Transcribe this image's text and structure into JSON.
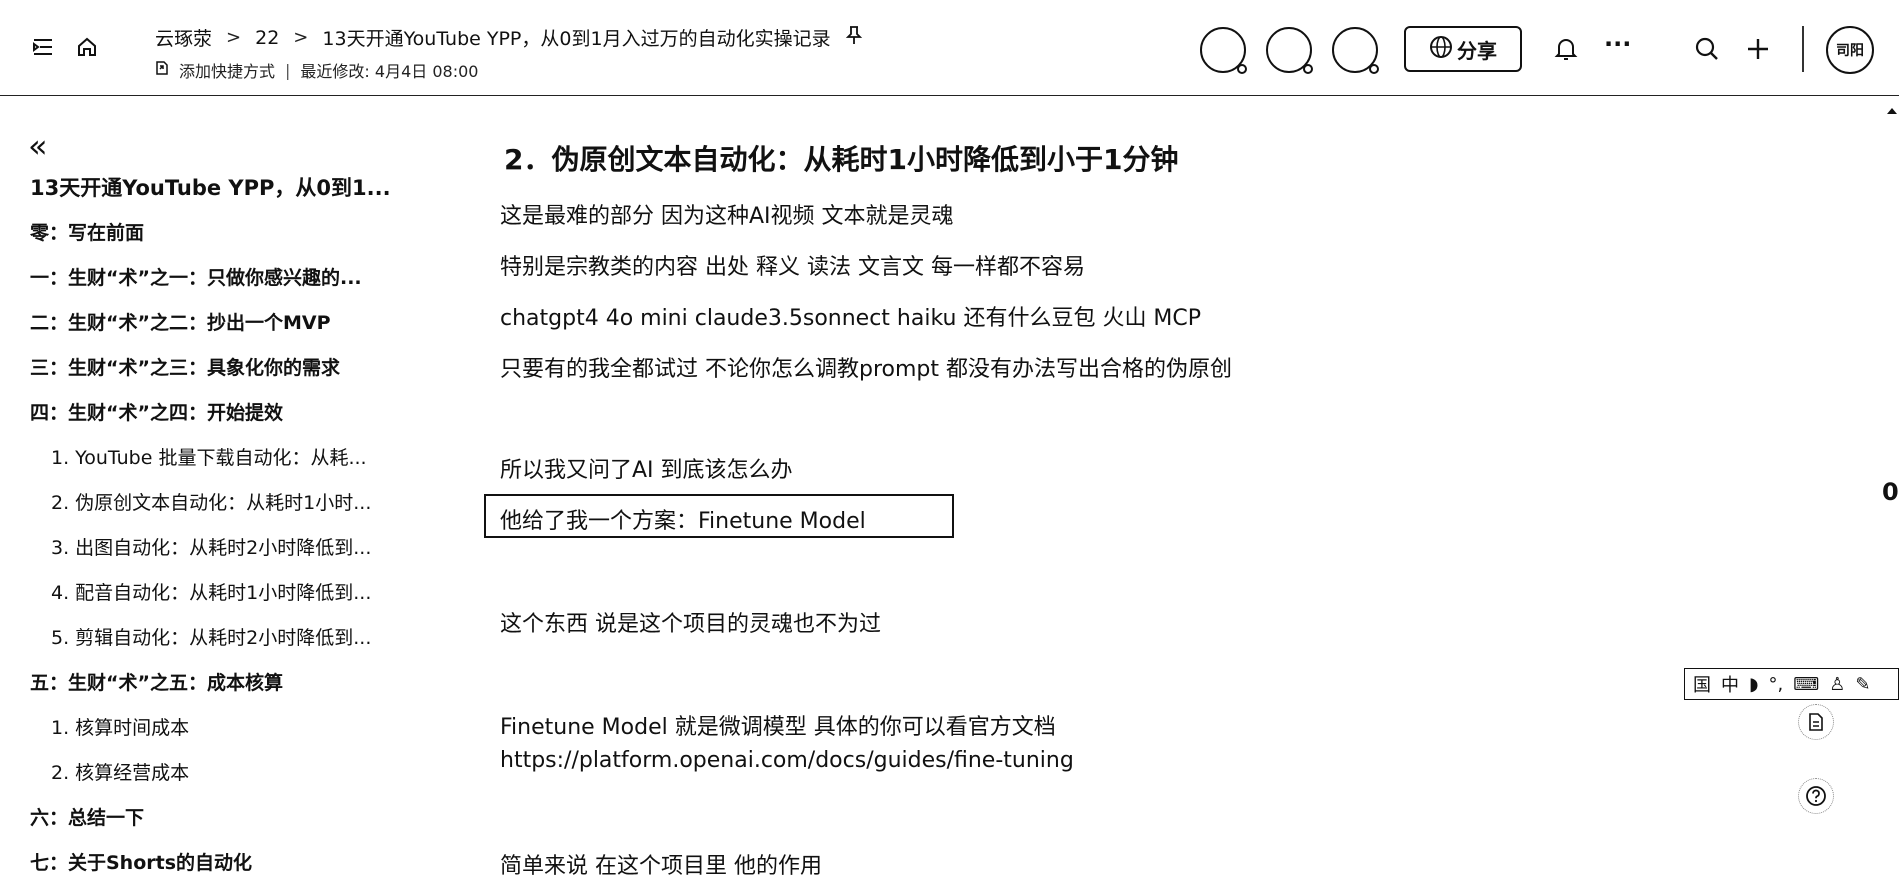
{
  "breadcrumb": {
    "items": [
      "云琢荥",
      "22",
      "13天开通YouTube YPP，从0到1月入过万的自动化实操记录"
    ],
    "pin_icon": "pin-icon"
  },
  "meta": {
    "add_shortcut": "添加快捷方式",
    "separator": "|",
    "last_modified": "最近修改: 4月4日 08:00"
  },
  "toolbar": {
    "share_label": "分享",
    "more_label": "···",
    "user_initials": "司阳"
  },
  "sidebar": {
    "collapse_label": "«",
    "items": [
      {
        "label": "13天开通YouTube YPP，从0到1...",
        "level": "title"
      },
      {
        "label": "零：写在前面",
        "level": "h"
      },
      {
        "label": "一：生财“术”之一：只做你感兴趣的...",
        "level": "h"
      },
      {
        "label": "二：生财“术”之二：抄出一个MVP",
        "level": "h"
      },
      {
        "label": "三：生财“术”之三：具象化你的需求",
        "level": "h"
      },
      {
        "label": "四：生财“术”之四：开始提效",
        "level": "h"
      },
      {
        "label": "1. YouTube 批量下载自动化：从耗...",
        "level": "sub"
      },
      {
        "label": "2. 伪原创文本自动化：从耗时1小时...",
        "level": "sub"
      },
      {
        "label": "3. 出图自动化：从耗时2小时降低到...",
        "level": "sub"
      },
      {
        "label": "4. 配音自动化：从耗时1小时降低到...",
        "level": "sub"
      },
      {
        "label": "5. 剪辑自动化：从耗时2小时降低到...",
        "level": "sub"
      },
      {
        "label": "五：生财“术”之五：成本核算",
        "level": "h"
      },
      {
        "label": "1. 核算时间成本",
        "level": "sub"
      },
      {
        "label": "2. 核算经营成本",
        "level": "sub"
      },
      {
        "label": "六：总结一下",
        "level": "h"
      },
      {
        "label": "七：关于Shorts的自动化",
        "level": "h"
      }
    ]
  },
  "article": {
    "heading": "2．伪原创文本自动化：从耗时1小时降低到小于1分钟",
    "p1": "这是最难的部分 因为这种AI视频 文本就是灵魂",
    "p2": "特别是宗教类的内容 出处 释义 读法 文言文 每一样都不容易",
    "p3": "chatgpt4 4o mini claude3.5sonnect haiku 还有什么豆包 火山 MCP",
    "p4": "只要有的我全都试过 不论你怎么调教prompt 都没有办法写出合格的伪原创",
    "p5": "所以我又问了AI  到底该怎么办",
    "p6": "他给了我一个方案：Finetune Model",
    "p7": "这个东西 说是这个项目的灵魂也不为过",
    "p8": "Finetune Model 就是微调模型 具体的你可以看官方文档",
    "p9": "https://platform.openai.com/docs/guides/fine-tuning",
    "p10": "简单来说 在这个项目里 他的作用"
  },
  "ime_bar": {
    "items": [
      "国",
      "中",
      "◗",
      "°,",
      "⌨",
      "♙",
      "✎"
    ]
  },
  "right_edge": {
    "scroll_marker": "0"
  }
}
